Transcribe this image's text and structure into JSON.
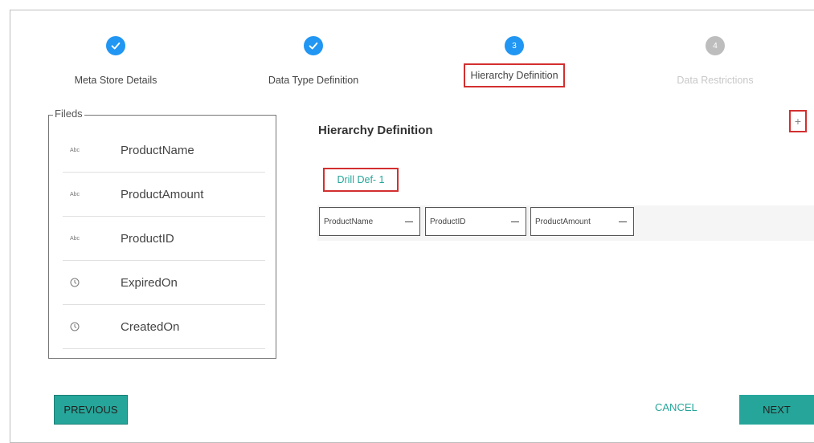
{
  "stepper": {
    "steps": [
      {
        "label": "Meta Store Details",
        "status": "done",
        "marker": ""
      },
      {
        "label": "Data Type Definition",
        "status": "done",
        "marker": ""
      },
      {
        "label": "Hierarchy Definition",
        "status": "active",
        "marker": "3"
      },
      {
        "label": "Data Restrictions",
        "status": "pending",
        "marker": "4"
      }
    ]
  },
  "fields": {
    "legend": "Fileds",
    "items": [
      {
        "type": "text",
        "type_label": "Abc",
        "name": "ProductName"
      },
      {
        "type": "text",
        "type_label": "Abc",
        "name": "ProductAmount"
      },
      {
        "type": "text",
        "type_label": "Abc",
        "name": "ProductID"
      },
      {
        "type": "date",
        "type_label": "",
        "name": "ExpiredOn"
      },
      {
        "type": "date",
        "type_label": "",
        "name": "CreatedOn"
      }
    ]
  },
  "hierarchy": {
    "title": "Hierarchy Definition",
    "add_label": "+",
    "drill_tab": "Drill Def- 1",
    "chips": [
      "ProductName",
      "ProductID",
      "ProductAmount"
    ]
  },
  "footer": {
    "previous_label": "PREVIOUS",
    "cancel_label": "CANCEL",
    "next_label": "NEXT"
  },
  "colors": {
    "step_active": "#2196f3",
    "step_pending": "#bdbdbd",
    "accent_teal": "#26a69a",
    "highlight_red": "#d32f2f"
  }
}
